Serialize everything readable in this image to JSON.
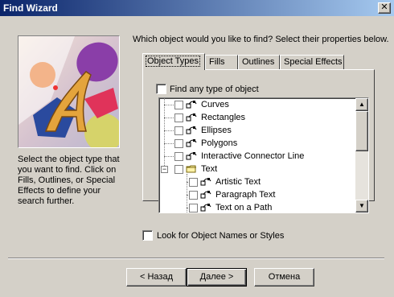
{
  "window": {
    "title": "Find Wizard",
    "close_glyph": "✕"
  },
  "question": "Which object would you like to find?  Select their properties below.",
  "left_description": "Select the object type that you want to find. Click on Fills, Outlines, or Special Effects to define your search further.",
  "tabs": [
    {
      "label": "Object Types",
      "active": true
    },
    {
      "label": "Fills",
      "active": false
    },
    {
      "label": "Outlines",
      "active": false
    },
    {
      "label": "Special Effects",
      "active": false
    }
  ],
  "find_any": {
    "label": "Find any type of object",
    "checked": false
  },
  "tree": {
    "items": [
      {
        "label": "Curves",
        "icon": "curve-tool-icon",
        "checked": false,
        "level": 0
      },
      {
        "label": "Rectangles",
        "icon": "rectangle-tool-icon",
        "checked": false,
        "level": 0
      },
      {
        "label": "Ellipses",
        "icon": "ellipse-tool-icon",
        "checked": false,
        "level": 0
      },
      {
        "label": "Polygons",
        "icon": "polygon-tool-icon",
        "checked": false,
        "level": 0
      },
      {
        "label": "Interactive Connector Line",
        "icon": "connector-tool-icon",
        "checked": false,
        "level": 0
      },
      {
        "label": "Text",
        "icon": "folder-icon",
        "checked": false,
        "level": 0,
        "expanded": true
      },
      {
        "label": "Artistic Text",
        "icon": "artistic-text-icon",
        "checked": false,
        "level": 1
      },
      {
        "label": "Paragraph Text",
        "icon": "paragraph-text-icon",
        "checked": false,
        "level": 1
      },
      {
        "label": "Text on a Path",
        "icon": "text-path-icon",
        "checked": false,
        "level": 1
      }
    ],
    "expander_glyph": "−"
  },
  "look_for_names": {
    "label": "Look for Object Names or Styles",
    "checked": false
  },
  "buttons": {
    "back": "< Назад",
    "next": "Далее >",
    "cancel": "Отмена"
  }
}
